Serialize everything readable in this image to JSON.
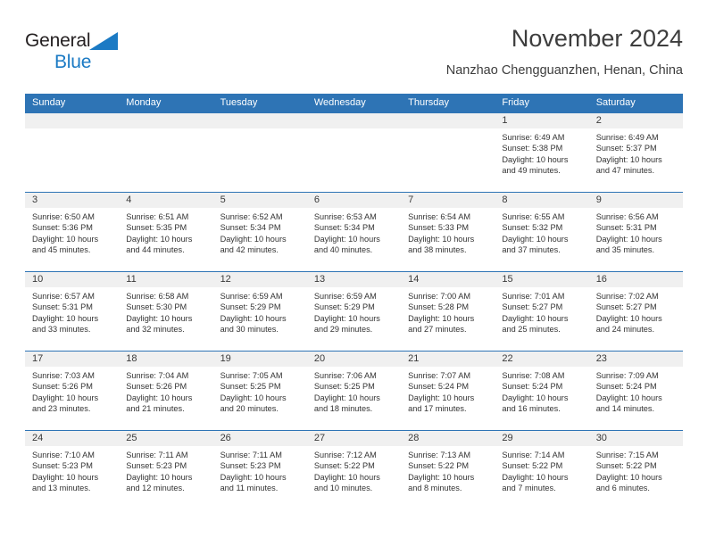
{
  "brand": {
    "name_part1": "General",
    "name_part2": "Blue",
    "triangle_color": "#1b7ac4"
  },
  "header": {
    "title": "November 2024",
    "subtitle": "Nanzhao Chengguanzhen, Henan, China"
  },
  "colors": {
    "header_blue": "#2e74b5",
    "date_band": "#f0f0f0",
    "text": "#333333"
  },
  "calendar": {
    "weekday_headers": [
      "Sunday",
      "Monday",
      "Tuesday",
      "Wednesday",
      "Thursday",
      "Friday",
      "Saturday"
    ],
    "weeks": [
      [
        {
          "date": "",
          "empty": true
        },
        {
          "date": "",
          "empty": true
        },
        {
          "date": "",
          "empty": true
        },
        {
          "date": "",
          "empty": true
        },
        {
          "date": "",
          "empty": true
        },
        {
          "date": "1",
          "sunrise": "Sunrise: 6:49 AM",
          "sunset": "Sunset: 5:38 PM",
          "daylight1": "Daylight: 10 hours",
          "daylight2": "and 49 minutes."
        },
        {
          "date": "2",
          "sunrise": "Sunrise: 6:49 AM",
          "sunset": "Sunset: 5:37 PM",
          "daylight1": "Daylight: 10 hours",
          "daylight2": "and 47 minutes."
        }
      ],
      [
        {
          "date": "3",
          "sunrise": "Sunrise: 6:50 AM",
          "sunset": "Sunset: 5:36 PM",
          "daylight1": "Daylight: 10 hours",
          "daylight2": "and 45 minutes."
        },
        {
          "date": "4",
          "sunrise": "Sunrise: 6:51 AM",
          "sunset": "Sunset: 5:35 PM",
          "daylight1": "Daylight: 10 hours",
          "daylight2": "and 44 minutes."
        },
        {
          "date": "5",
          "sunrise": "Sunrise: 6:52 AM",
          "sunset": "Sunset: 5:34 PM",
          "daylight1": "Daylight: 10 hours",
          "daylight2": "and 42 minutes."
        },
        {
          "date": "6",
          "sunrise": "Sunrise: 6:53 AM",
          "sunset": "Sunset: 5:34 PM",
          "daylight1": "Daylight: 10 hours",
          "daylight2": "and 40 minutes."
        },
        {
          "date": "7",
          "sunrise": "Sunrise: 6:54 AM",
          "sunset": "Sunset: 5:33 PM",
          "daylight1": "Daylight: 10 hours",
          "daylight2": "and 38 minutes."
        },
        {
          "date": "8",
          "sunrise": "Sunrise: 6:55 AM",
          "sunset": "Sunset: 5:32 PM",
          "daylight1": "Daylight: 10 hours",
          "daylight2": "and 37 minutes."
        },
        {
          "date": "9",
          "sunrise": "Sunrise: 6:56 AM",
          "sunset": "Sunset: 5:31 PM",
          "daylight1": "Daylight: 10 hours",
          "daylight2": "and 35 minutes."
        }
      ],
      [
        {
          "date": "10",
          "sunrise": "Sunrise: 6:57 AM",
          "sunset": "Sunset: 5:31 PM",
          "daylight1": "Daylight: 10 hours",
          "daylight2": "and 33 minutes."
        },
        {
          "date": "11",
          "sunrise": "Sunrise: 6:58 AM",
          "sunset": "Sunset: 5:30 PM",
          "daylight1": "Daylight: 10 hours",
          "daylight2": "and 32 minutes."
        },
        {
          "date": "12",
          "sunrise": "Sunrise: 6:59 AM",
          "sunset": "Sunset: 5:29 PM",
          "daylight1": "Daylight: 10 hours",
          "daylight2": "and 30 minutes."
        },
        {
          "date": "13",
          "sunrise": "Sunrise: 6:59 AM",
          "sunset": "Sunset: 5:29 PM",
          "daylight1": "Daylight: 10 hours",
          "daylight2": "and 29 minutes."
        },
        {
          "date": "14",
          "sunrise": "Sunrise: 7:00 AM",
          "sunset": "Sunset: 5:28 PM",
          "daylight1": "Daylight: 10 hours",
          "daylight2": "and 27 minutes."
        },
        {
          "date": "15",
          "sunrise": "Sunrise: 7:01 AM",
          "sunset": "Sunset: 5:27 PM",
          "daylight1": "Daylight: 10 hours",
          "daylight2": "and 25 minutes."
        },
        {
          "date": "16",
          "sunrise": "Sunrise: 7:02 AM",
          "sunset": "Sunset: 5:27 PM",
          "daylight1": "Daylight: 10 hours",
          "daylight2": "and 24 minutes."
        }
      ],
      [
        {
          "date": "17",
          "sunrise": "Sunrise: 7:03 AM",
          "sunset": "Sunset: 5:26 PM",
          "daylight1": "Daylight: 10 hours",
          "daylight2": "and 23 minutes."
        },
        {
          "date": "18",
          "sunrise": "Sunrise: 7:04 AM",
          "sunset": "Sunset: 5:26 PM",
          "daylight1": "Daylight: 10 hours",
          "daylight2": "and 21 minutes."
        },
        {
          "date": "19",
          "sunrise": "Sunrise: 7:05 AM",
          "sunset": "Sunset: 5:25 PM",
          "daylight1": "Daylight: 10 hours",
          "daylight2": "and 20 minutes."
        },
        {
          "date": "20",
          "sunrise": "Sunrise: 7:06 AM",
          "sunset": "Sunset: 5:25 PM",
          "daylight1": "Daylight: 10 hours",
          "daylight2": "and 18 minutes."
        },
        {
          "date": "21",
          "sunrise": "Sunrise: 7:07 AM",
          "sunset": "Sunset: 5:24 PM",
          "daylight1": "Daylight: 10 hours",
          "daylight2": "and 17 minutes."
        },
        {
          "date": "22",
          "sunrise": "Sunrise: 7:08 AM",
          "sunset": "Sunset: 5:24 PM",
          "daylight1": "Daylight: 10 hours",
          "daylight2": "and 16 minutes."
        },
        {
          "date": "23",
          "sunrise": "Sunrise: 7:09 AM",
          "sunset": "Sunset: 5:24 PM",
          "daylight1": "Daylight: 10 hours",
          "daylight2": "and 14 minutes."
        }
      ],
      [
        {
          "date": "24",
          "sunrise": "Sunrise: 7:10 AM",
          "sunset": "Sunset: 5:23 PM",
          "daylight1": "Daylight: 10 hours",
          "daylight2": "and 13 minutes."
        },
        {
          "date": "25",
          "sunrise": "Sunrise: 7:11 AM",
          "sunset": "Sunset: 5:23 PM",
          "daylight1": "Daylight: 10 hours",
          "daylight2": "and 12 minutes."
        },
        {
          "date": "26",
          "sunrise": "Sunrise: 7:11 AM",
          "sunset": "Sunset: 5:23 PM",
          "daylight1": "Daylight: 10 hours",
          "daylight2": "and 11 minutes."
        },
        {
          "date": "27",
          "sunrise": "Sunrise: 7:12 AM",
          "sunset": "Sunset: 5:22 PM",
          "daylight1": "Daylight: 10 hours",
          "daylight2": "and 10 minutes."
        },
        {
          "date": "28",
          "sunrise": "Sunrise: 7:13 AM",
          "sunset": "Sunset: 5:22 PM",
          "daylight1": "Daylight: 10 hours",
          "daylight2": "and 8 minutes."
        },
        {
          "date": "29",
          "sunrise": "Sunrise: 7:14 AM",
          "sunset": "Sunset: 5:22 PM",
          "daylight1": "Daylight: 10 hours",
          "daylight2": "and 7 minutes."
        },
        {
          "date": "30",
          "sunrise": "Sunrise: 7:15 AM",
          "sunset": "Sunset: 5:22 PM",
          "daylight1": "Daylight: 10 hours",
          "daylight2": "and 6 minutes."
        }
      ]
    ]
  }
}
